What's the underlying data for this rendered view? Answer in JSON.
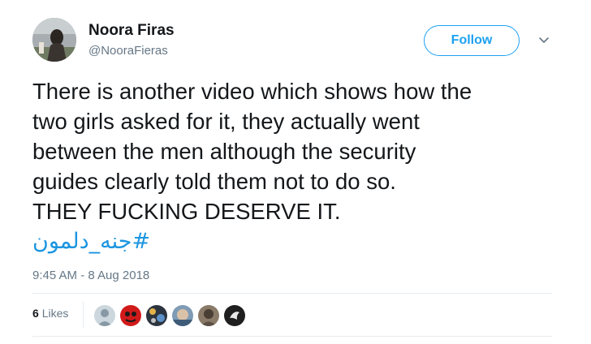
{
  "tweet": {
    "display_name": "Noora Firas",
    "handle": "@NooraFieras",
    "follow_label": "Follow",
    "text_lines": [
      "There is another video which shows how the",
      "two girls asked for it, they actually went",
      "between the men although the security",
      "guides clearly told them not to do so.",
      "THEY FUCKING DESERVE IT."
    ],
    "hashtag": "#جنه_دلمون",
    "timestamp": "9:45 AM - 8 Aug 2018",
    "likes_count": "6",
    "likes_label": "Likes"
  },
  "colors": {
    "link_blue": "#1b95e0",
    "follow_blue": "#1da1f2",
    "muted_gray": "#657786",
    "text_dark": "#14171a",
    "divider": "#e6ecf0"
  },
  "icons": {
    "caret": "chevron-down-icon",
    "avatar": "profile-avatar",
    "likers": [
      "default-avatar",
      "red-mask-avatar",
      "bird-pattern-avatar",
      "blue-face-avatar",
      "sepia-photo-avatar",
      "dark-logo-avatar"
    ]
  }
}
